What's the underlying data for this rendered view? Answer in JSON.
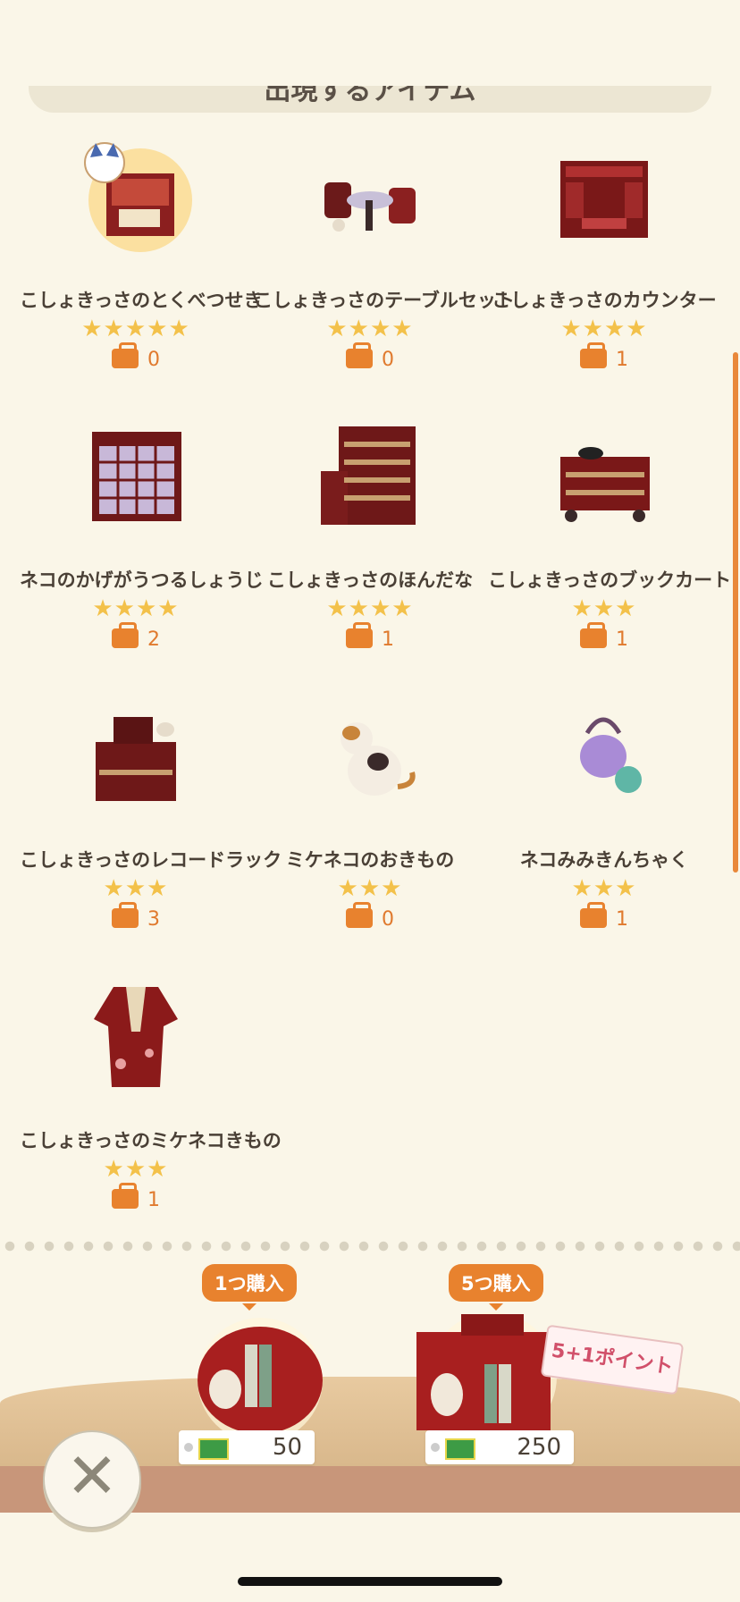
{
  "section_title": "出現するアイテム",
  "items": [
    {
      "name": "こしょきっさのとくべつせき",
      "stars": "★★★★★",
      "count": "0"
    },
    {
      "name": "こしょきっさのテーブルセット",
      "stars": "★★★★",
      "count": "0"
    },
    {
      "name": "こしょきっさのカウンター",
      "stars": "★★★★",
      "count": "1"
    },
    {
      "name": "ネコのかげがうつるしょうじ",
      "stars": "★★★★",
      "count": "2"
    },
    {
      "name": "こしょきっさのほんだな",
      "stars": "★★★★",
      "count": "1"
    },
    {
      "name": "こしょきっさのブックカート",
      "stars": "★★★",
      "count": "1"
    },
    {
      "name": "こしょきっさのレコードラック",
      "stars": "★★★",
      "count": "3"
    },
    {
      "name": "ミケネコのおきもの",
      "stars": "★★★",
      "count": "0"
    },
    {
      "name": "ネコみみきんちゃく",
      "stars": "★★★",
      "count": "1"
    },
    {
      "name": "こしょきっさのミケネコきもの",
      "stars": "★★★",
      "count": "1"
    }
  ],
  "purchase": {
    "single": {
      "label": "1つ購入",
      "price": "50"
    },
    "multi": {
      "label": "5つ購入",
      "price": "250",
      "bonus": "5+1ポイント"
    }
  },
  "colors": {
    "accent": "#e8822e",
    "star": "#f3c14a",
    "background": "#faf6e8"
  }
}
